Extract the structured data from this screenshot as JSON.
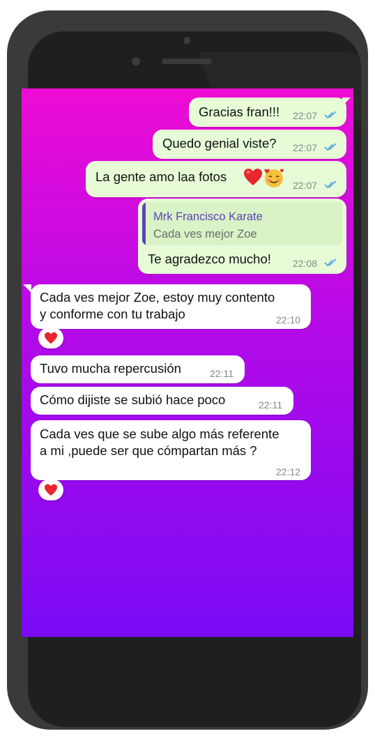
{
  "chat": {
    "messages": [
      {
        "text": "Gracias fran!!!",
        "time": "22:07"
      },
      {
        "text": "Quedo genial viste?",
        "time": "22:07"
      },
      {
        "text": "La gente amo laa fotos ",
        "time": "22:07"
      },
      {
        "quote_author": "Mrk Francisco Karate",
        "quote_text": "Cada ves mejor Zoe",
        "text": "Te agradezco mucho!",
        "time": "22:08"
      },
      {
        "line1": "Cada ves mejor Zoe, estoy muy contento",
        "line2": "y conforme con tu trabajo",
        "time": "22:10",
        "reaction": "heart"
      },
      {
        "text": "Tuvo mucha repercusión",
        "time": "22:11"
      },
      {
        "text": "Cómo dijiste se subió hace poco",
        "time": "22:11"
      },
      {
        "line1": "Cada ves que se sube algo más referente",
        "line2": "a mi ,puede ser que cómpartan más ?",
        "time": "22:12",
        "reaction": "heart"
      }
    ]
  },
  "colors": {
    "outgoing_bubble": "#e7fbd7",
    "incoming_bubble": "#ffffff",
    "read_ticks": "#4aa3df",
    "quote_author": "#5b43b5",
    "background_top": "#ee0cd5",
    "background_bottom": "#7a0af5"
  },
  "icons": [
    "read-receipt-ticks-icon",
    "red-heart-emoji",
    "smiling-face-with-hearts-emoji",
    "heart-reaction-icon"
  ]
}
